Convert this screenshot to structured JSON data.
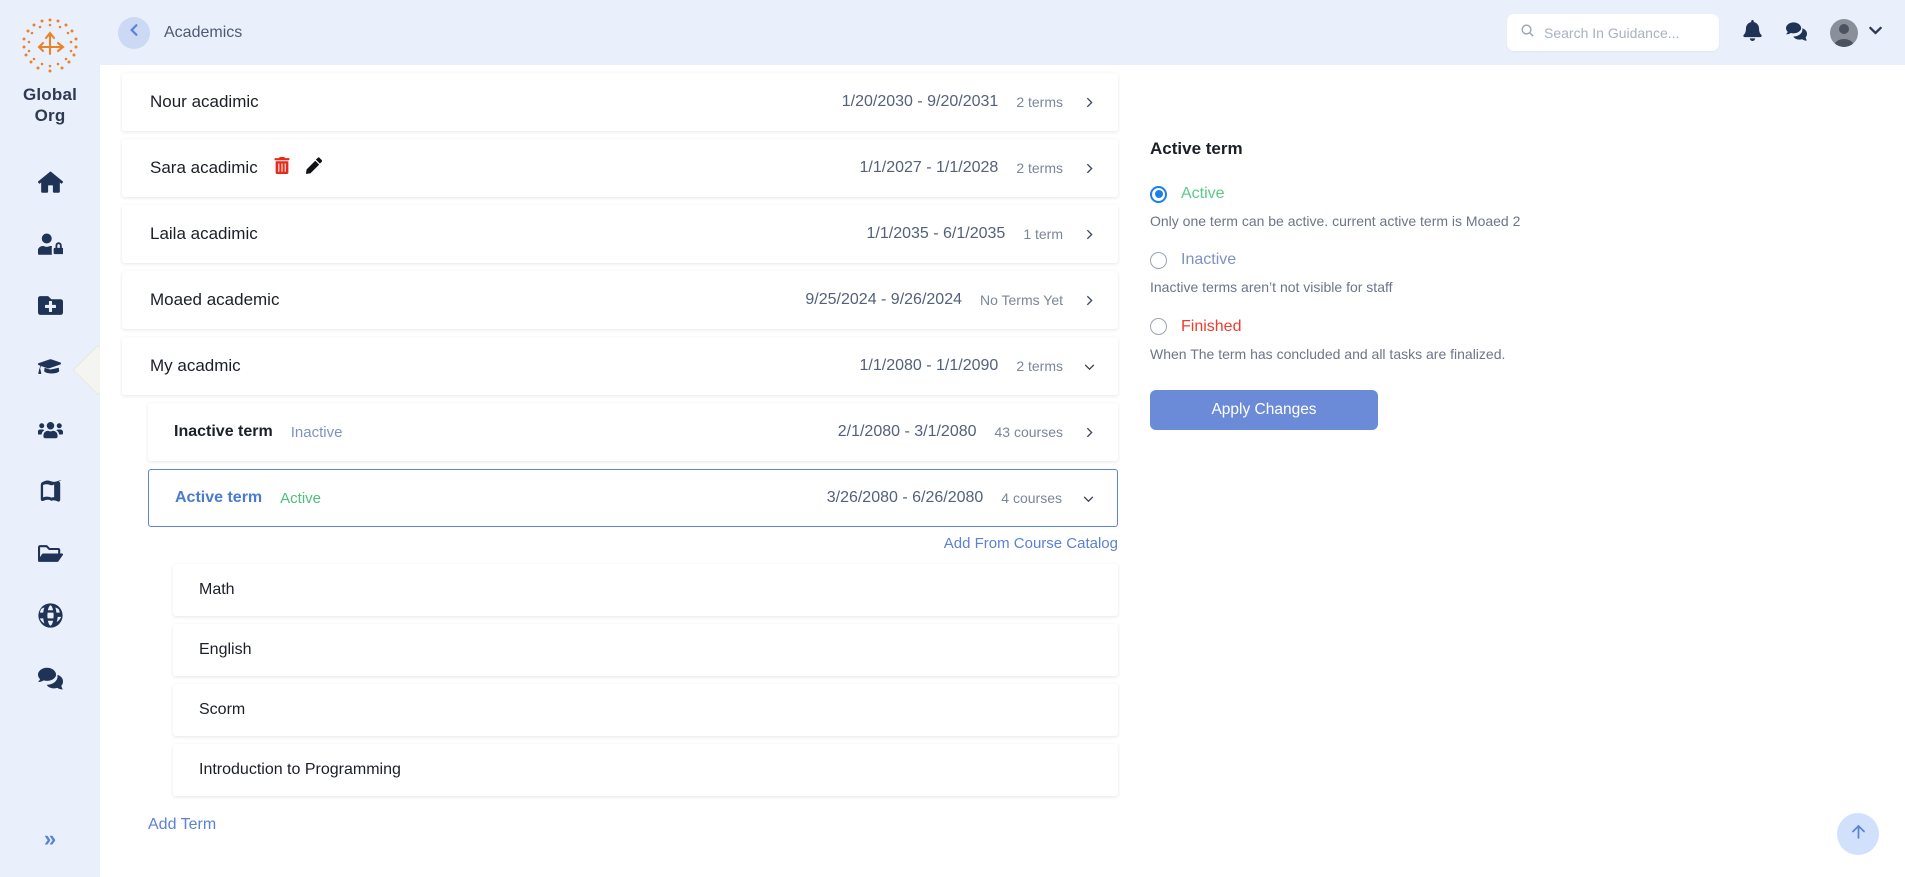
{
  "brand": {
    "line1": "Global",
    "line2": "Org",
    "logo_icon": "org-compass-logo"
  },
  "sidebar": {
    "items": [
      {
        "icon": "home-icon",
        "name": "home",
        "active": false
      },
      {
        "icon": "user-lock-icon",
        "name": "permissions",
        "active": false
      },
      {
        "icon": "folder-plus-icon",
        "name": "add-folder",
        "active": false
      },
      {
        "icon": "graduation-cap-icon",
        "name": "academics",
        "active": true
      },
      {
        "icon": "users-icon",
        "name": "users",
        "active": false
      },
      {
        "icon": "book-icon",
        "name": "courses",
        "active": false
      },
      {
        "icon": "folder-open-icon",
        "name": "files",
        "active": false
      },
      {
        "icon": "globe-icon",
        "name": "sites",
        "active": false
      },
      {
        "icon": "comments-icon",
        "name": "messages",
        "active": false
      }
    ],
    "collapse_icon": "double-chevron-right-icon"
  },
  "header": {
    "back_icon": "chevron-left-icon",
    "breadcrumb": "Academics",
    "search": {
      "placeholder": "Search In Guidance...",
      "value": "",
      "icon": "search-icon"
    },
    "notifications_icon": "bell-icon",
    "messages_icon": "comments-icon",
    "avatar_icon": "user-avatar",
    "account_menu_icon": "chevron-down-icon"
  },
  "academics": [
    {
      "name": "Nour acadimic",
      "dates": "1/20/2030 - 9/20/2031",
      "terms": "2 terms",
      "chevron": "chevron-right-icon",
      "expanded": false,
      "actions": false
    },
    {
      "name": "Sara acadimic",
      "dates": "1/1/2027 - 1/1/2028",
      "terms": "2 terms",
      "chevron": "chevron-right-icon",
      "expanded": false,
      "actions": true,
      "delete_icon": "trash-icon",
      "edit_icon": "pencil-icon"
    },
    {
      "name": "Laila acadimic",
      "dates": "1/1/2035 - 6/1/2035",
      "terms": "1 term",
      "chevron": "chevron-right-icon",
      "expanded": false,
      "actions": false
    },
    {
      "name": "Moaed academic",
      "dates": "9/25/2024 - 9/26/2024",
      "terms": "No Terms Yet",
      "chevron": "chevron-right-icon",
      "expanded": false,
      "actions": false
    },
    {
      "name": "My acadmic",
      "dates": "1/1/2080 - 1/1/2090",
      "terms": "2 terms",
      "chevron": "chevron-down-icon",
      "expanded": true,
      "actions": false
    }
  ],
  "terms": [
    {
      "name": "Inactive term",
      "status": "Inactive",
      "status_kind": "inactive",
      "dates": "2/1/2080 - 3/1/2080",
      "courses": "43 courses",
      "chevron": "chevron-right-icon",
      "selected": false
    },
    {
      "name": "Active term",
      "status": "Active",
      "status_kind": "active",
      "dates": "3/26/2080 - 6/26/2080",
      "courses": "4 courses",
      "chevron": "chevron-down-icon",
      "selected": true
    }
  ],
  "catalog_link": "Add From Course Catalog",
  "courses": [
    {
      "name": "Math"
    },
    {
      "name": "English"
    },
    {
      "name": "Scorm"
    },
    {
      "name": "Introduction to Programming"
    }
  ],
  "add_term_link": "Add Term",
  "detail_panel": {
    "title": "Active term",
    "options": [
      {
        "label": "Active",
        "kind": "active",
        "checked": true,
        "help": "Only one term can be active. current active term is  Moaed 2"
      },
      {
        "label": "Inactive",
        "kind": "inactive",
        "checked": false,
        "help": "Inactive terms aren’t not visible for staff"
      },
      {
        "label": "Finished",
        "kind": "finished",
        "checked": false,
        "help": "When The term has concluded and all tasks are finalized."
      }
    ],
    "apply_label": "Apply Changes"
  },
  "scroll_top": {
    "icon": "arrow-up-icon"
  },
  "colors": {
    "sidebar_bg": "#eaf0fb",
    "brand_orange": "#e8832a",
    "navy": "#1e3356",
    "accent_blue": "#5b82d4",
    "apply_button": "#6b8ad8",
    "green": "#5bc98a",
    "red": "#ee3b2f",
    "radio_blue": "#1e7de8"
  }
}
